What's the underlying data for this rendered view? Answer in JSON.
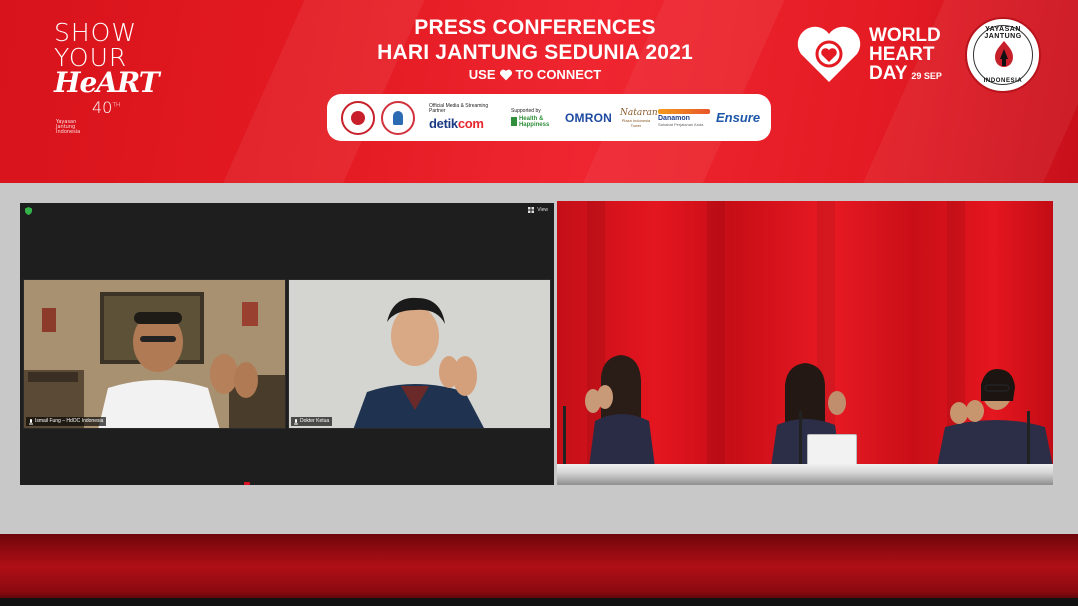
{
  "banner": {
    "show_heart": {
      "line1": "SHOW",
      "line2": "YOUR",
      "line3": "HeART",
      "line4": "40",
      "line4_sup": "TH",
      "line4_caption": "Yayasan Jantung Indonesia"
    },
    "title_line1": "PRESS CONFERENCES",
    "title_line2": "HARI JANTUNG SEDUNIA 2021",
    "tagline_left": "USE",
    "tagline_right": "TO CONNECT",
    "world_heart_day": {
      "line1": "WORLD",
      "line2": "HEART",
      "line3": "DAY",
      "date": "29 SEP"
    },
    "yji_logo": {
      "top": "YAYASAN JANTUNG",
      "bottom": "INDONESIA"
    },
    "colors": {
      "banner_red": "#e41a22",
      "white": "#ffffff"
    }
  },
  "sponsors": {
    "media_caption": "Official Media & Streaming Partner",
    "media_brand_main": "detik",
    "media_brand_suffix": "com",
    "supported_caption": "Supported by",
    "health_happiness": "Health & Happiness",
    "omron": "OMRON",
    "nataran": "Nataran",
    "nataran_sub": "Plaza Indonesia Tower",
    "danamon": "Danamon",
    "danamon_sub": "Sahabat Perjalanan Anda",
    "ensure": "Ensure"
  },
  "zoom": {
    "view_label": "View",
    "participants": [
      {
        "name": "Ismail Fung – HdOC Indonesia"
      },
      {
        "name": "Dokter Ketua"
      }
    ]
  }
}
